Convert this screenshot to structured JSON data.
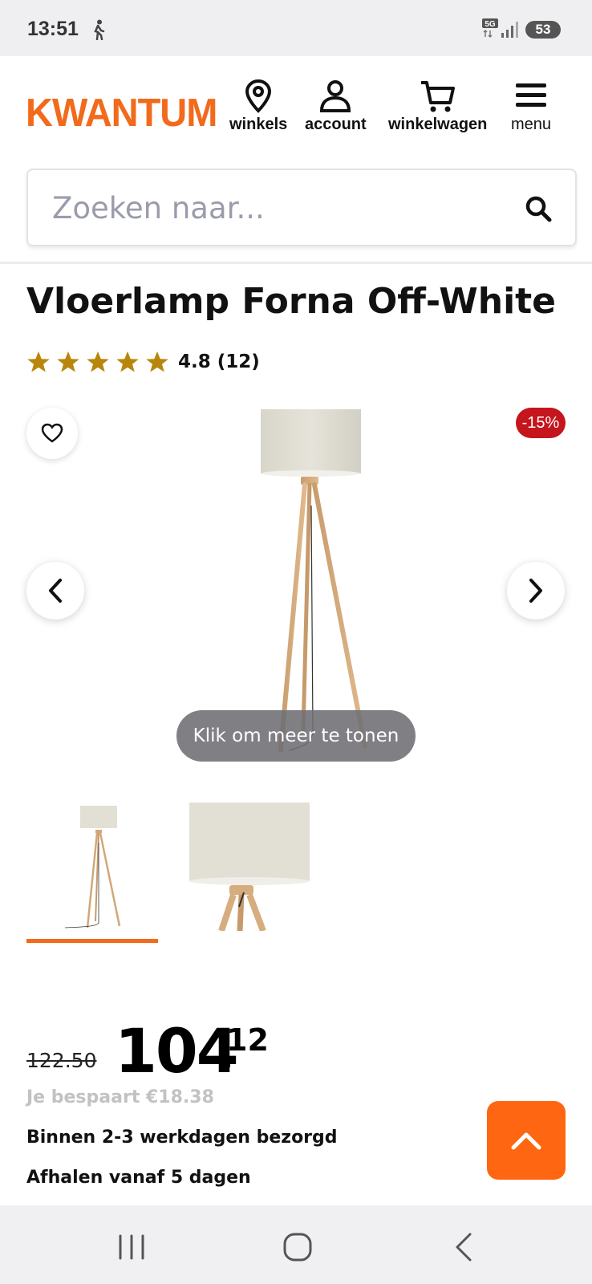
{
  "status_bar": {
    "time": "13:51",
    "network": "5G",
    "battery": "53"
  },
  "header": {
    "logo": "KWANTUM",
    "nav": [
      {
        "label": "winkels",
        "icon": "location-pin-icon"
      },
      {
        "label": "account",
        "icon": "user-icon"
      },
      {
        "label": "winkelwagen",
        "icon": "cart-icon"
      },
      {
        "label": "menu",
        "icon": "hamburger-icon"
      }
    ]
  },
  "search": {
    "placeholder": "Zoeken naar..."
  },
  "product": {
    "title": "Vloerlamp Forna Off-White",
    "rating": {
      "stars": 4.8,
      "text": "4.8 (12)"
    },
    "discount_badge": "-15%",
    "show_more": "Klik om meer te tonen",
    "thumbnails": [
      "Vloerlamp volledig",
      "Lampenkap detail"
    ],
    "active_thumbnail": 0
  },
  "pricing": {
    "old_price": "122.50",
    "price_main": "104",
    "price_cents": "12",
    "savings": "Je bespaart €18.38",
    "delivery": "Binnen 2-3 werkdagen bezorgd",
    "pickup": "Afhalen vanaf 5 dagen"
  },
  "colors": {
    "brand": "#f26a1b",
    "scroll_top": "#ff6611",
    "discount": "#c4161c",
    "star": "#b8860b"
  }
}
